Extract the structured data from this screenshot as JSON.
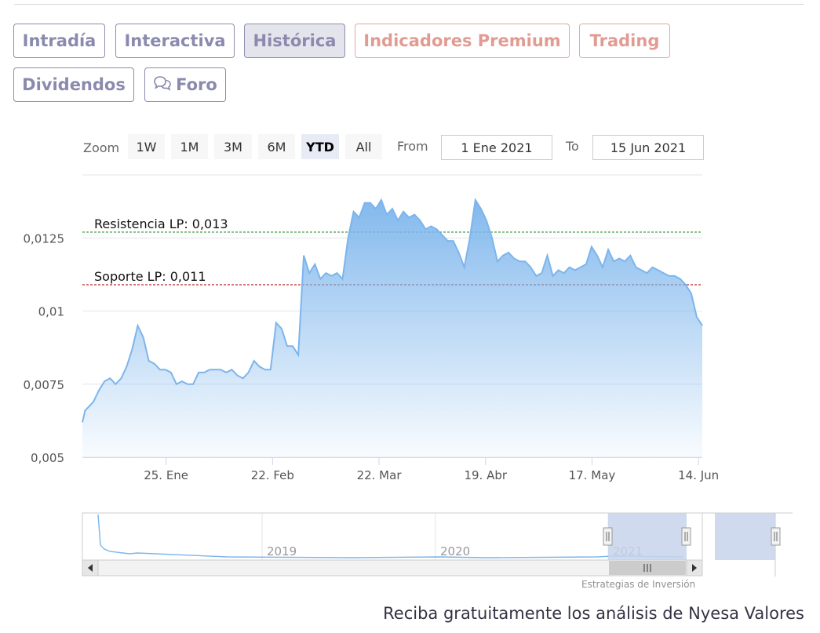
{
  "tabs": [
    {
      "label": "Intradía",
      "active": false,
      "premium": false
    },
    {
      "label": "Interactiva",
      "active": false,
      "premium": false
    },
    {
      "label": "Histórica",
      "active": true,
      "premium": false
    },
    {
      "label": "Indicadores Premium",
      "active": false,
      "premium": true
    },
    {
      "label": "Trading",
      "active": false,
      "premium": true
    },
    {
      "label": "Dividendos",
      "active": false,
      "premium": false
    },
    {
      "label": "Foro",
      "active": false,
      "premium": false,
      "icon": "chat-bubble-icon"
    }
  ],
  "range_selector": {
    "zoom_label": "Zoom",
    "buttons": [
      "1W",
      "1M",
      "3M",
      "6M",
      "YTD",
      "All"
    ],
    "active": "YTD",
    "from_label": "From",
    "from_value": "1 Ene 2021",
    "to_label": "To",
    "to_value": "15 Jun 2021"
  },
  "chart_data": {
    "type": "area",
    "y_ticks": [
      "0,005",
      "0,0075",
      "0,01",
      "0,0125"
    ],
    "y_tick_values": [
      0.005,
      0.0075,
      0.01,
      0.0125
    ],
    "ylim": [
      0.005,
      0.0142
    ],
    "x_ticks": [
      "25. Ene",
      "22. Feb",
      "22. Mar",
      "19. Abr",
      "17. May",
      "14. Jun"
    ],
    "x_tick_days": [
      24,
      52,
      80,
      108,
      136,
      164
    ],
    "xlim_days": [
      2,
      165
    ],
    "plot_lines": [
      {
        "label": "Resistencia LP: 0,013",
        "value": 0.0127,
        "color": "#2a8a2a"
      },
      {
        "label": "Soporte LP: 0,011",
        "value": 0.0109,
        "color": "#b02a2a"
      }
    ],
    "series": [
      {
        "color": "#7cb5ec",
        "points": [
          [
            2,
            0.0062
          ],
          [
            3,
            0.0066
          ],
          [
            4,
            0.0067
          ],
          [
            6,
            0.0069
          ],
          [
            8,
            0.0073
          ],
          [
            10,
            0.0076
          ],
          [
            12,
            0.0077
          ],
          [
            14,
            0.0075
          ],
          [
            16,
            0.0077
          ],
          [
            18,
            0.0081
          ],
          [
            20,
            0.0087
          ],
          [
            22,
            0.0095
          ],
          [
            24,
            0.0091
          ],
          [
            26,
            0.0083
          ],
          [
            28,
            0.0082
          ],
          [
            30,
            0.008
          ],
          [
            32,
            0.008
          ],
          [
            34,
            0.0079
          ],
          [
            36,
            0.0075
          ],
          [
            38,
            0.0076
          ],
          [
            40,
            0.0075
          ],
          [
            42,
            0.0075
          ],
          [
            44,
            0.0079
          ],
          [
            46,
            0.0079
          ],
          [
            48,
            0.008
          ],
          [
            50,
            0.008
          ],
          [
            52,
            0.008
          ],
          [
            54,
            0.0079
          ],
          [
            56,
            0.008
          ],
          [
            58,
            0.0078
          ],
          [
            60,
            0.0077
          ],
          [
            62,
            0.0079
          ],
          [
            64,
            0.0083
          ],
          [
            66,
            0.0081
          ],
          [
            68,
            0.008
          ],
          [
            70,
            0.008
          ],
          [
            72,
            0.0096
          ],
          [
            74,
            0.0094
          ],
          [
            76,
            0.0088
          ],
          [
            78,
            0.0088
          ],
          [
            80,
            0.0085
          ],
          [
            82,
            0.0119
          ],
          [
            84,
            0.0113
          ],
          [
            86,
            0.0116
          ],
          [
            88,
            0.0111
          ],
          [
            90,
            0.0113
          ],
          [
            92,
            0.0112
          ],
          [
            94,
            0.0113
          ],
          [
            96,
            0.0111
          ],
          [
            98,
            0.0125
          ],
          [
            100,
            0.0134
          ],
          [
            102,
            0.0132
          ],
          [
            104,
            0.0137
          ],
          [
            106,
            0.0137
          ],
          [
            108,
            0.0135
          ],
          [
            110,
            0.0138
          ],
          [
            112,
            0.0133
          ],
          [
            114,
            0.0135
          ],
          [
            116,
            0.0131
          ],
          [
            118,
            0.0134
          ],
          [
            120,
            0.0132
          ],
          [
            122,
            0.0133
          ],
          [
            124,
            0.0131
          ],
          [
            126,
            0.0128
          ],
          [
            128,
            0.0129
          ],
          [
            130,
            0.0128
          ],
          [
            132,
            0.0126
          ],
          [
            134,
            0.0124
          ],
          [
            136,
            0.0124
          ],
          [
            138,
            0.012
          ],
          [
            140,
            0.0115
          ],
          [
            142,
            0.0125
          ],
          [
            144,
            0.0138
          ],
          [
            146,
            0.0135
          ],
          [
            148,
            0.0131
          ],
          [
            150,
            0.0125
          ],
          [
            152,
            0.0117
          ],
          [
            154,
            0.0119
          ],
          [
            156,
            0.012
          ],
          [
            158,
            0.0118
          ],
          [
            160,
            0.0117
          ],
          [
            162,
            0.0117
          ],
          [
            164,
            0.0115
          ],
          [
            166,
            0.0112
          ],
          [
            168,
            0.0113
          ],
          [
            170,
            0.0119
          ],
          [
            172,
            0.0112
          ],
          [
            174,
            0.0114
          ],
          [
            176,
            0.0113
          ],
          [
            178,
            0.0115
          ],
          [
            180,
            0.0114
          ],
          [
            182,
            0.0115
          ],
          [
            184,
            0.0116
          ],
          [
            186,
            0.0122
          ],
          [
            188,
            0.0119
          ],
          [
            190,
            0.0115
          ],
          [
            192,
            0.0121
          ],
          [
            194,
            0.0117
          ],
          [
            196,
            0.0118
          ],
          [
            198,
            0.0117
          ],
          [
            200,
            0.0119
          ],
          [
            202,
            0.0115
          ],
          [
            204,
            0.0114
          ],
          [
            206,
            0.0113
          ],
          [
            208,
            0.0115
          ],
          [
            210,
            0.0114
          ],
          [
            212,
            0.0113
          ],
          [
            214,
            0.0112
          ],
          [
            216,
            0.0112
          ],
          [
            218,
            0.0111
          ],
          [
            220,
            0.0109
          ],
          [
            222,
            0.0106
          ],
          [
            224,
            0.0098
          ],
          [
            226,
            0.0095
          ]
        ]
      }
    ],
    "navigator": {
      "year_labels": [
        "2019",
        "2020",
        "2021"
      ],
      "scroll_icon": "grip-icon"
    }
  },
  "credit": "Estrategias de Inversión",
  "footer": "Reciba gratuitamente los análisis de Nyesa Valores"
}
